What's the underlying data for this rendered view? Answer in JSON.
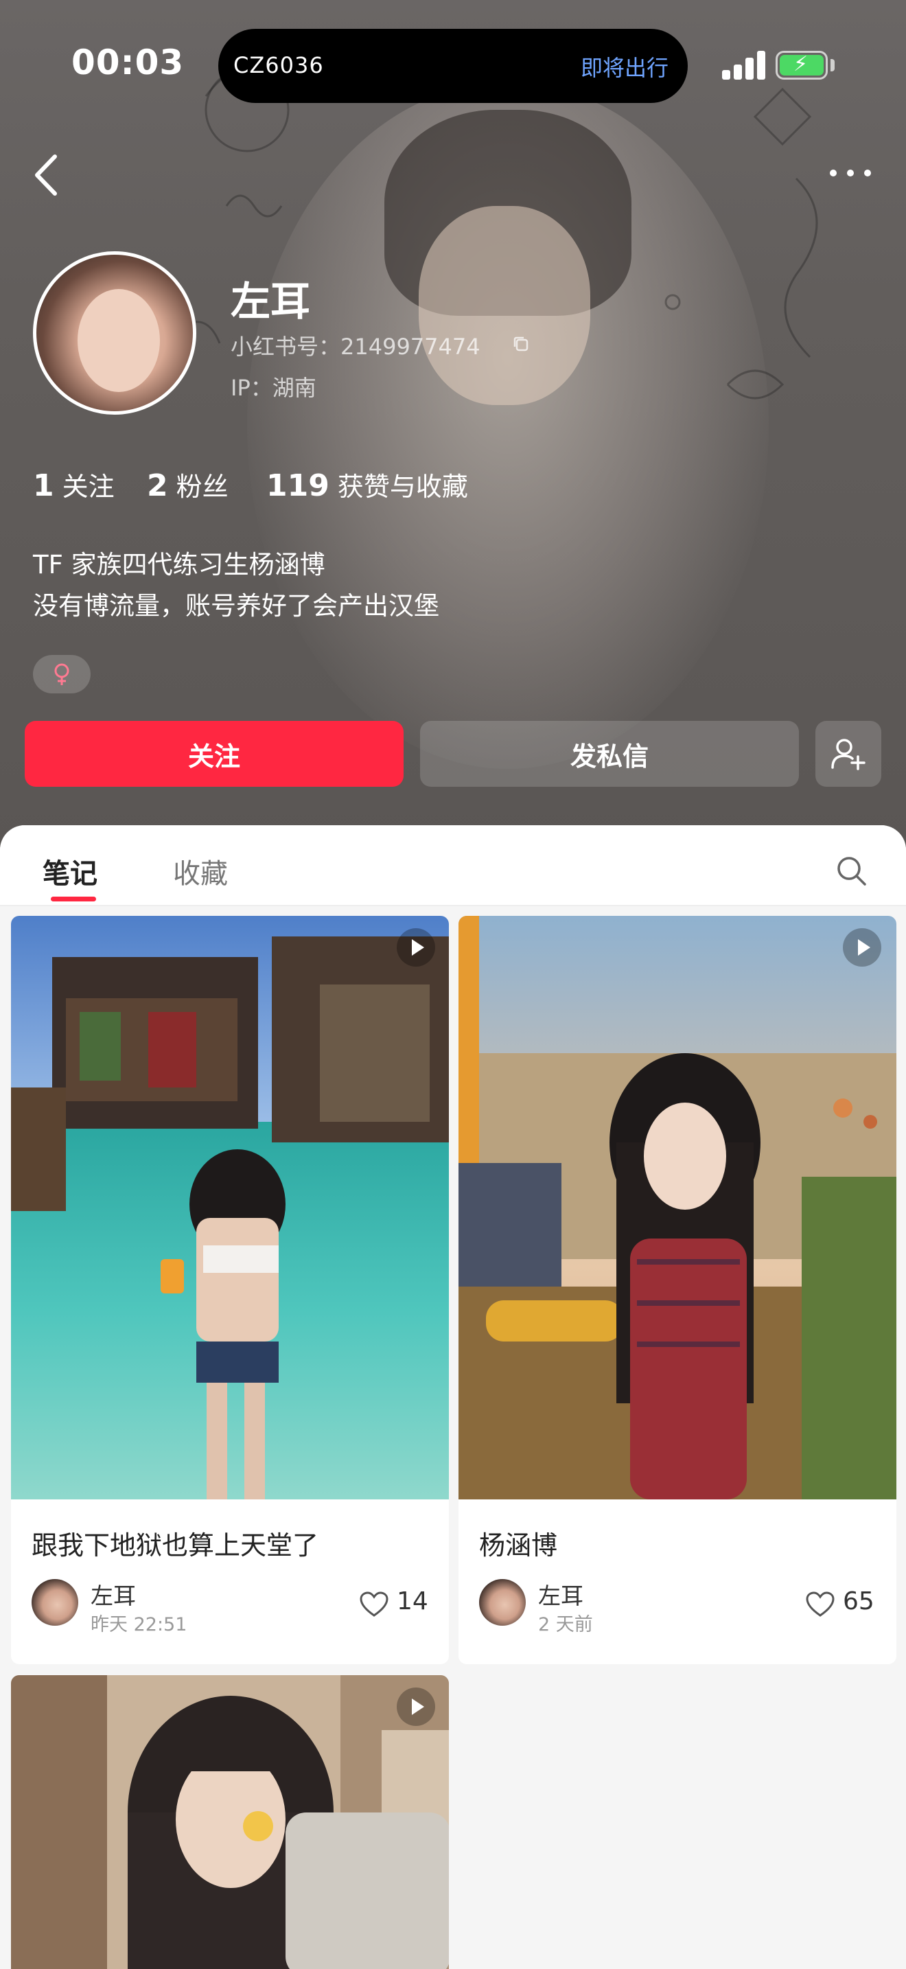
{
  "status_bar": {
    "time": "00:03",
    "island_flight": "CZ6036",
    "island_status": "即将出行"
  },
  "profile": {
    "name": "左耳",
    "redbook_id": "小红书号：2149977474",
    "ip": "IP：湖南",
    "stats": [
      {
        "value": "1",
        "label": "关注"
      },
      {
        "value": "2",
        "label": "粉丝"
      },
      {
        "value": "119",
        "label": "获赞与收藏"
      }
    ],
    "bio_lines": [
      "TF 家族四代练习生杨涵博",
      "没有博流量，账号养好了会产出汉堡"
    ],
    "gender_symbol": "♀"
  },
  "actions": {
    "follow_label": "关注",
    "message_label": "发私信"
  },
  "tabs": [
    {
      "label": "笔记",
      "active": true
    },
    {
      "label": "收藏",
      "active": false
    }
  ],
  "notes": [
    {
      "title": "跟我下地狱也算上天堂了",
      "author": "左耳",
      "time": "昨天 22:51",
      "likes": "14",
      "is_video": true
    },
    {
      "title": "杨涵博",
      "author": "左耳",
      "time": "2 天前",
      "likes": "65",
      "is_video": true
    },
    {
      "title": "",
      "author": "",
      "time": "",
      "likes": "",
      "is_video": true
    }
  ],
  "colors": {
    "accent": "#ff2741",
    "island_status": "#6fa4ff",
    "battery": "#4cd964"
  },
  "icons": [
    "back-icon",
    "more-icon",
    "copy-icon",
    "female-icon",
    "add-friend-icon",
    "search-icon",
    "video-play-icon",
    "heart-icon"
  ]
}
